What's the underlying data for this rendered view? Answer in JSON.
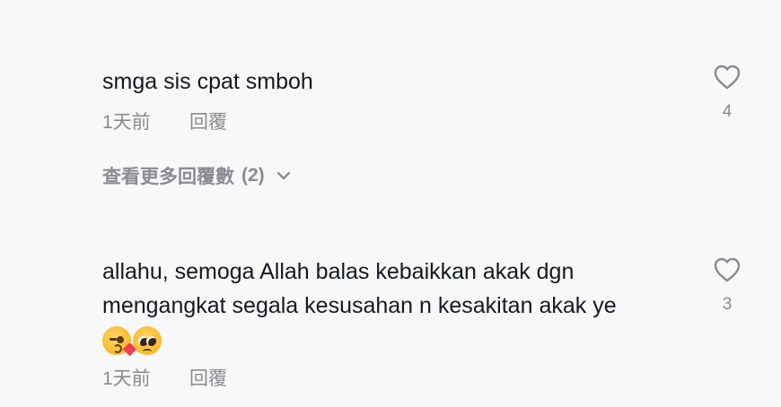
{
  "comments": [
    {
      "text": "smga sis cpat smboh",
      "time": "1天前",
      "reply_label": "回覆",
      "like_count": "4",
      "view_replies_label": "查看更多回覆數",
      "view_replies_count": "(2)"
    },
    {
      "text_line1": "allahu, semoga Allah balas kebaikkan akak dgn",
      "text_line2": "mengangkat segala kesusahan n kesakitan akak ye",
      "emojis": [
        "kissing-face-with-heart-emoji",
        "pleading-face-emoji"
      ],
      "time": "1天前",
      "reply_label": "回覆",
      "like_count": "3"
    }
  ],
  "colors": {
    "background": "#f8f8f8",
    "text_primary": "#161823",
    "text_secondary": "#8a8b91"
  },
  "icons": {
    "like": "heart-outline-icon",
    "expand": "chevron-down-icon"
  }
}
